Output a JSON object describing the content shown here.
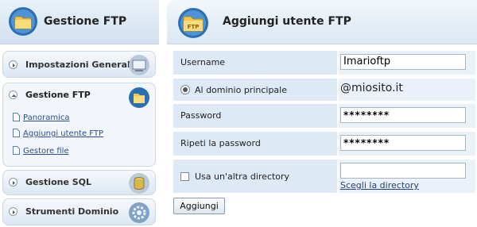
{
  "sidebar": {
    "title": "Gestione FTP",
    "sections": [
      {
        "label": "Impostazioni Generali",
        "icon": "settings-monitor-icon"
      },
      {
        "label": "Gestione FTP",
        "icon": "folder-icon",
        "expanded": true,
        "items": [
          "Panoramica",
          "Aggiungi utente FTP",
          "Gestore file"
        ]
      },
      {
        "label": "Gestione SQL",
        "icon": "database-icon"
      },
      {
        "label": "Strumenti Dominio",
        "icon": "globe-gear-icon"
      }
    ]
  },
  "form": {
    "title": "Aggiungi utente FTP",
    "username_label": "Username",
    "username_value": "Imarioftp",
    "domain_radio_label": "Al dominio principale",
    "domain_prefix": "@",
    "domain_value": "miosito.it",
    "password_label": "Password",
    "password_value": "********",
    "repeat_password_label": "Ripeti la password",
    "repeat_password_value": "********",
    "other_dir_label": "Usa un'altra directory",
    "other_dir_value": "",
    "choose_dir_link": "Scegli la directory",
    "submit_label": "Aggiungi"
  },
  "colors": {
    "header_bg": "#dbe7f2",
    "label_cell": "#dde9f5",
    "link": "#2a4f8f"
  }
}
